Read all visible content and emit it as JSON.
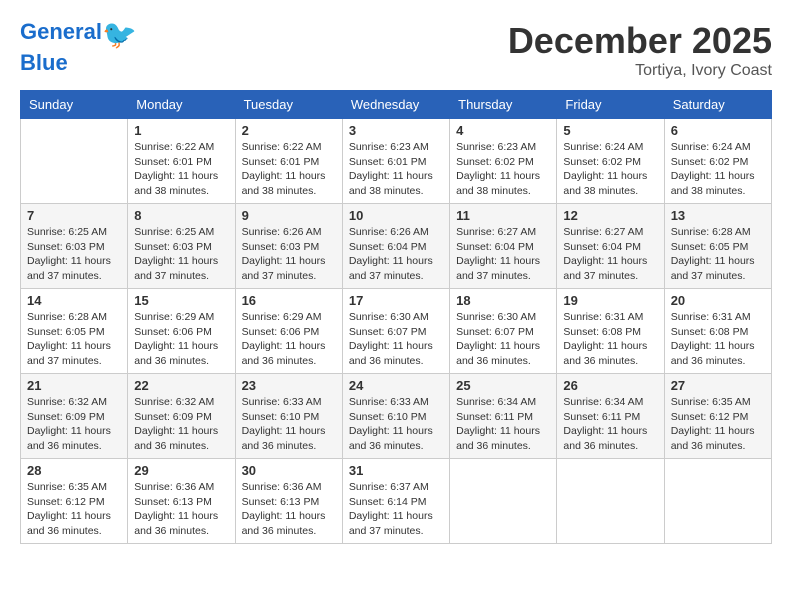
{
  "header": {
    "logo_line1": "General",
    "logo_line2": "Blue",
    "month": "December 2025",
    "location": "Tortiya, Ivory Coast"
  },
  "days_of_week": [
    "Sunday",
    "Monday",
    "Tuesday",
    "Wednesday",
    "Thursday",
    "Friday",
    "Saturday"
  ],
  "weeks": [
    [
      {
        "day": "",
        "info": ""
      },
      {
        "day": "1",
        "info": "Sunrise: 6:22 AM\nSunset: 6:01 PM\nDaylight: 11 hours and 38 minutes."
      },
      {
        "day": "2",
        "info": "Sunrise: 6:22 AM\nSunset: 6:01 PM\nDaylight: 11 hours and 38 minutes."
      },
      {
        "day": "3",
        "info": "Sunrise: 6:23 AM\nSunset: 6:01 PM\nDaylight: 11 hours and 38 minutes."
      },
      {
        "day": "4",
        "info": "Sunrise: 6:23 AM\nSunset: 6:02 PM\nDaylight: 11 hours and 38 minutes."
      },
      {
        "day": "5",
        "info": "Sunrise: 6:24 AM\nSunset: 6:02 PM\nDaylight: 11 hours and 38 minutes."
      },
      {
        "day": "6",
        "info": "Sunrise: 6:24 AM\nSunset: 6:02 PM\nDaylight: 11 hours and 38 minutes."
      }
    ],
    [
      {
        "day": "7",
        "info": "Sunrise: 6:25 AM\nSunset: 6:03 PM\nDaylight: 11 hours and 37 minutes."
      },
      {
        "day": "8",
        "info": "Sunrise: 6:25 AM\nSunset: 6:03 PM\nDaylight: 11 hours and 37 minutes."
      },
      {
        "day": "9",
        "info": "Sunrise: 6:26 AM\nSunset: 6:03 PM\nDaylight: 11 hours and 37 minutes."
      },
      {
        "day": "10",
        "info": "Sunrise: 6:26 AM\nSunset: 6:04 PM\nDaylight: 11 hours and 37 minutes."
      },
      {
        "day": "11",
        "info": "Sunrise: 6:27 AM\nSunset: 6:04 PM\nDaylight: 11 hours and 37 minutes."
      },
      {
        "day": "12",
        "info": "Sunrise: 6:27 AM\nSunset: 6:04 PM\nDaylight: 11 hours and 37 minutes."
      },
      {
        "day": "13",
        "info": "Sunrise: 6:28 AM\nSunset: 6:05 PM\nDaylight: 11 hours and 37 minutes."
      }
    ],
    [
      {
        "day": "14",
        "info": "Sunrise: 6:28 AM\nSunset: 6:05 PM\nDaylight: 11 hours and 37 minutes."
      },
      {
        "day": "15",
        "info": "Sunrise: 6:29 AM\nSunset: 6:06 PM\nDaylight: 11 hours and 36 minutes."
      },
      {
        "day": "16",
        "info": "Sunrise: 6:29 AM\nSunset: 6:06 PM\nDaylight: 11 hours and 36 minutes."
      },
      {
        "day": "17",
        "info": "Sunrise: 6:30 AM\nSunset: 6:07 PM\nDaylight: 11 hours and 36 minutes."
      },
      {
        "day": "18",
        "info": "Sunrise: 6:30 AM\nSunset: 6:07 PM\nDaylight: 11 hours and 36 minutes."
      },
      {
        "day": "19",
        "info": "Sunrise: 6:31 AM\nSunset: 6:08 PM\nDaylight: 11 hours and 36 minutes."
      },
      {
        "day": "20",
        "info": "Sunrise: 6:31 AM\nSunset: 6:08 PM\nDaylight: 11 hours and 36 minutes."
      }
    ],
    [
      {
        "day": "21",
        "info": "Sunrise: 6:32 AM\nSunset: 6:09 PM\nDaylight: 11 hours and 36 minutes."
      },
      {
        "day": "22",
        "info": "Sunrise: 6:32 AM\nSunset: 6:09 PM\nDaylight: 11 hours and 36 minutes."
      },
      {
        "day": "23",
        "info": "Sunrise: 6:33 AM\nSunset: 6:10 PM\nDaylight: 11 hours and 36 minutes."
      },
      {
        "day": "24",
        "info": "Sunrise: 6:33 AM\nSunset: 6:10 PM\nDaylight: 11 hours and 36 minutes."
      },
      {
        "day": "25",
        "info": "Sunrise: 6:34 AM\nSunset: 6:11 PM\nDaylight: 11 hours and 36 minutes."
      },
      {
        "day": "26",
        "info": "Sunrise: 6:34 AM\nSunset: 6:11 PM\nDaylight: 11 hours and 36 minutes."
      },
      {
        "day": "27",
        "info": "Sunrise: 6:35 AM\nSunset: 6:12 PM\nDaylight: 11 hours and 36 minutes."
      }
    ],
    [
      {
        "day": "28",
        "info": "Sunrise: 6:35 AM\nSunset: 6:12 PM\nDaylight: 11 hours and 36 minutes."
      },
      {
        "day": "29",
        "info": "Sunrise: 6:36 AM\nSunset: 6:13 PM\nDaylight: 11 hours and 36 minutes."
      },
      {
        "day": "30",
        "info": "Sunrise: 6:36 AM\nSunset: 6:13 PM\nDaylight: 11 hours and 36 minutes."
      },
      {
        "day": "31",
        "info": "Sunrise: 6:37 AM\nSunset: 6:14 PM\nDaylight: 11 hours and 37 minutes."
      },
      {
        "day": "",
        "info": ""
      },
      {
        "day": "",
        "info": ""
      },
      {
        "day": "",
        "info": ""
      }
    ]
  ]
}
